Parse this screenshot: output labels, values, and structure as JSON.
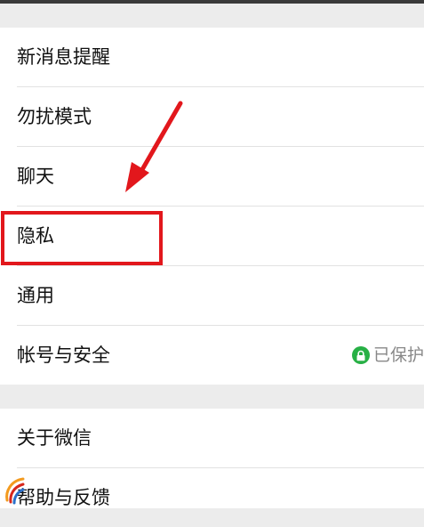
{
  "settings": {
    "items": [
      {
        "label": "新消息提醒"
      },
      {
        "label": "勿扰模式"
      },
      {
        "label": "聊天"
      },
      {
        "label": "隐私"
      },
      {
        "label": "通用"
      },
      {
        "label": "帐号与安全",
        "status": "已保护"
      }
    ],
    "secondary": [
      {
        "label": "关于微信"
      },
      {
        "label": "帮助与反馈"
      }
    ]
  },
  "annotation": {
    "highlighted_item": "隐私",
    "color": "#e2171c"
  },
  "colors": {
    "background": "#ececec",
    "row_background": "#ffffff",
    "text": "#111111",
    "status_text": "#888888",
    "lock_green": "#27b045"
  },
  "icons": [
    "lock-icon",
    "annotation-arrow",
    "watermark-logo"
  ]
}
